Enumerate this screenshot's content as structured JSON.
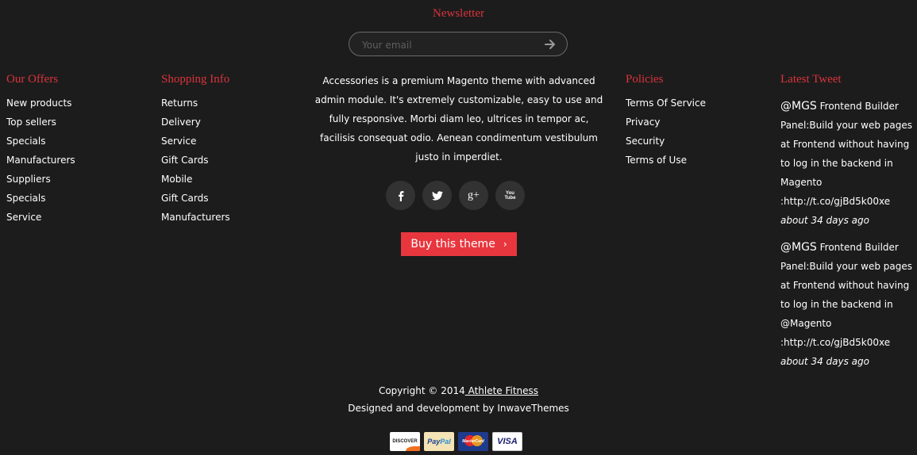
{
  "newsletter": {
    "title": "Newsletter",
    "placeholder": "Your email"
  },
  "offers": {
    "title": "Our Offers",
    "items": [
      "New products",
      "Top sellers",
      "Specials",
      "Manufacturers",
      "Suppliers",
      "Specials",
      "Service"
    ]
  },
  "shopping": {
    "title": "Shopping Info",
    "items": [
      "Returns",
      "Delivery",
      "Service",
      "Gift Cards",
      "Mobile",
      "Gift Cards",
      "Manufacturers"
    ]
  },
  "about": {
    "text": "Accessories is a premium Magento theme with advanced admin module. It's extremely customizable, easy to use and fully responsive. Morbi diam leo, ultrices in tempor ac, facilisis consequat odio. Aenean condimentum vestibulum justo in imperdiet."
  },
  "social": {
    "icons": [
      "facebook-icon",
      "twitter-icon",
      "google-plus-icon",
      "youtube-icon"
    ],
    "google_plus_glyph": "g+",
    "youtube_glyph": "You Tube"
  },
  "buy_button": {
    "label": "Buy this theme",
    "chevron": "›"
  },
  "policies": {
    "title": "Policies",
    "items": [
      "Terms Of Service",
      "Privacy",
      "Security",
      "Terms of Use"
    ]
  },
  "tweets": {
    "title": "Latest Tweet",
    "items": [
      {
        "handle": "@MGS",
        "text": " Frontend Builder Panel:Build your web pages at Frontend without having to log in the backend in Magento :http://t.co/gjBd5k00xe",
        "time": "about 34 days ago"
      },
      {
        "handle": "@MGS",
        "text": " Frontend Builder Panel:Build your web pages at Frontend without having to log in the backend in @Magento :http://t.co/gjBd5k00xe",
        "time": "about 34 days ago"
      }
    ]
  },
  "footer": {
    "copyright_prefix": "Copyright © 2014",
    "copyright_link": " Athlete Fitness",
    "credits": "Designed and development by InwaveThemes"
  },
  "payments": {
    "discover": "DISCOVER",
    "paypal_pay": "Pay",
    "paypal_pal": "Pal",
    "mastercard": "MasterCard",
    "visa": "VISA"
  },
  "colors": {
    "background": "#1d1c1c",
    "accent": "#d8343c",
    "button": "#e8363e",
    "social_bg": "#333232"
  }
}
